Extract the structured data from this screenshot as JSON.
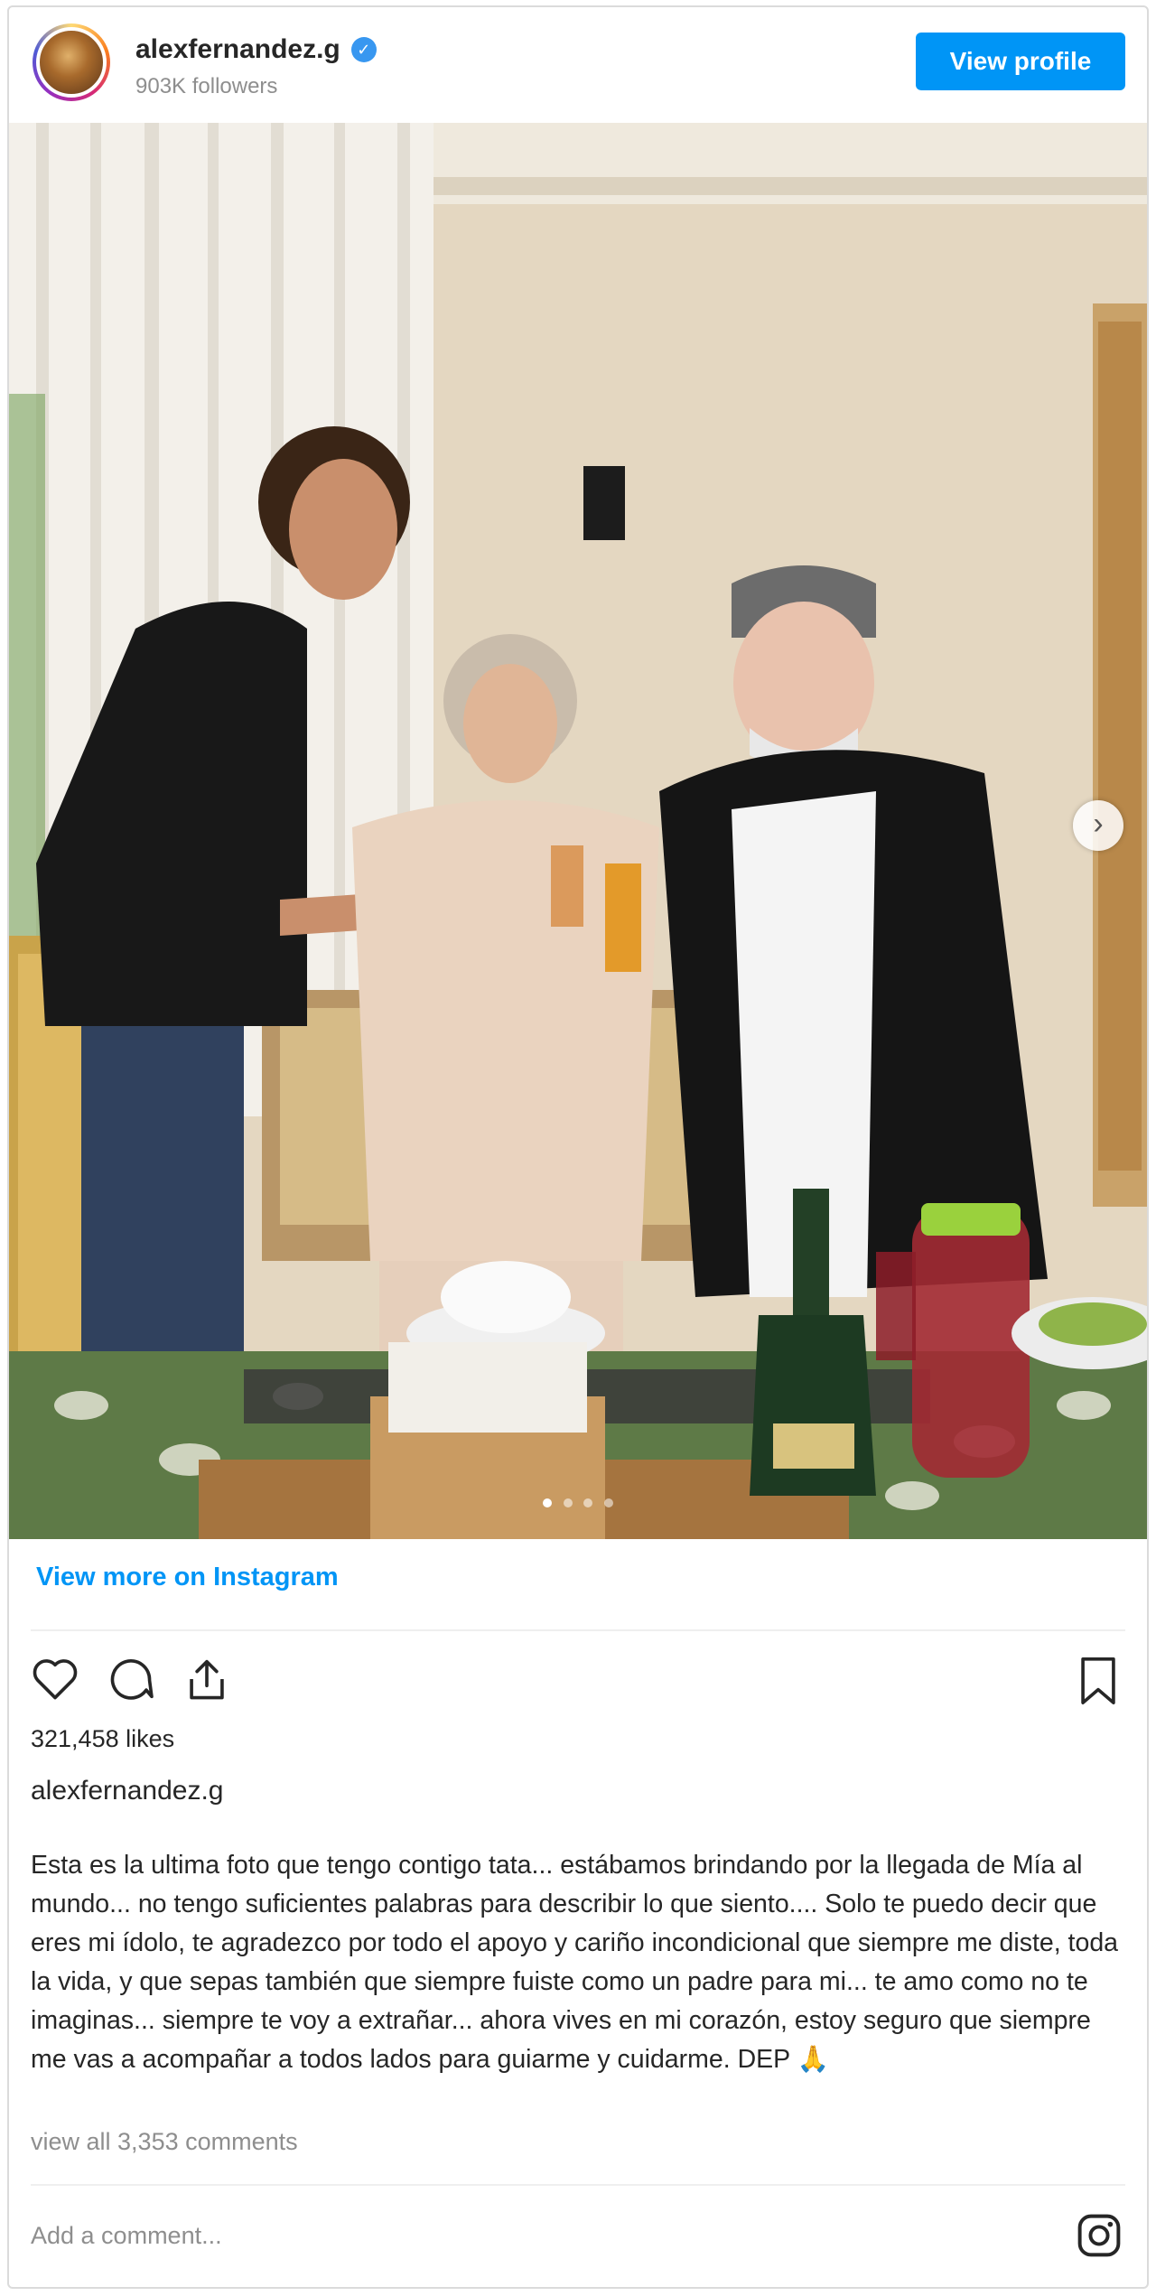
{
  "header": {
    "username": "alexfernandez.g",
    "verified_mark": "✓",
    "followers": "903K followers",
    "view_profile_label": "View profile"
  },
  "photo": {
    "description_icon": "photo-carousel",
    "next_arrow": "›",
    "slide_count": 4,
    "active_slide": 1
  },
  "links": {
    "view_more": "View more on Instagram"
  },
  "post": {
    "likes": "321,458 likes",
    "caption_user": "alexfernandez.g",
    "caption": "Esta es la ultima foto que tengo contigo tata... estábamos brindando por la llegada de Mía al mundo... no tengo suficientes palabras para describir lo que siento.... Solo te puedo decir que eres mi ídolo, te agradezco por todo el apoyo y cariño incondicional que siempre me diste, toda la vida, y que sepas también que siempre fuiste como un padre para mi... te amo como no te imaginas... siempre te voy a extrañar... ahora vives en mi corazón, estoy seguro que siempre me vas a acompañar a todos lados para guiarme y cuidarme. DEP 🙏",
    "view_comments": "view all 3,353 comments"
  },
  "comment_box": {
    "placeholder": "Add a comment..."
  },
  "icons": {
    "like": "heart-icon",
    "comment": "comment-icon",
    "share": "share-icon",
    "save": "bookmark-icon",
    "instagram": "instagram-icon"
  },
  "colors": {
    "accent": "#0095f6",
    "text": "#262626",
    "muted": "#8e8e8e",
    "border": "#dbdbdb"
  }
}
